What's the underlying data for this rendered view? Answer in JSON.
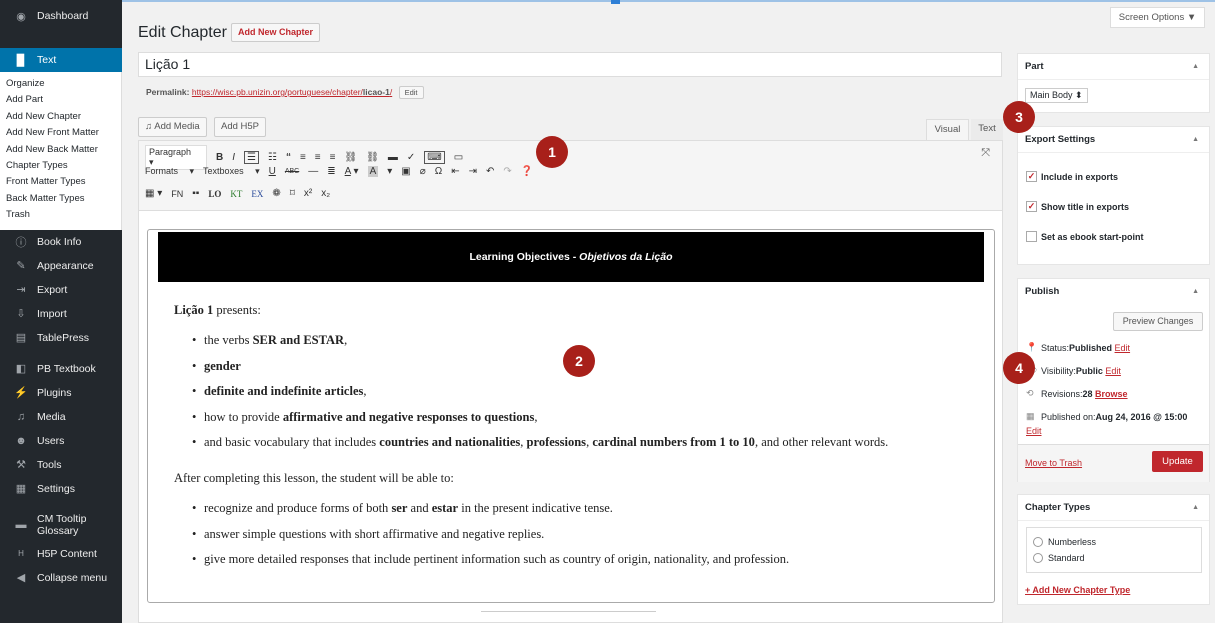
{
  "sidebar": {
    "dashboard": "Dashboard",
    "text": "Text",
    "submenu": [
      "Organize",
      "Add Part",
      "Add New Chapter",
      "Add New Front Matter",
      "Add New Back Matter",
      "Chapter Types",
      "Front Matter Types",
      "Back Matter Types",
      "Trash"
    ],
    "book_info": "Book Info",
    "appearance": "Appearance",
    "export": "Export",
    "import": "Import",
    "tablepress": "TablePress",
    "pb_textbook": "PB Textbook",
    "plugins": "Plugins",
    "media": "Media",
    "users": "Users",
    "tools": "Tools",
    "settings": "Settings",
    "cm_tooltip_1": "CM Tooltip",
    "cm_tooltip_2": "Glossary",
    "h5p": "H5P Content",
    "collapse": "Collapse menu"
  },
  "header": {
    "title": "Edit Chapter",
    "add_new": "Add New Chapter",
    "screen_options": "Screen Options ▼"
  },
  "post": {
    "title_value": "Lição 1",
    "permalink_label": "Permalink:",
    "permalink_url_pre": "https://wisc.pb.unizin.org/portuguese/chapter/",
    "permalink_slug": "licao-1",
    "permalink_url_post": "/",
    "permalink_edit": "Edit"
  },
  "editor": {
    "add_media": "Add Media",
    "add_h5p": "Add H5P",
    "tab_visual": "Visual",
    "tab_text": "Text",
    "paragraph": "Paragraph",
    "formats": "Formats",
    "textboxes": "Textboxes",
    "fn": "FN",
    "lo": "LO",
    "kt": "KT",
    "ex": "EX"
  },
  "content": {
    "lo_title": "Learning Objectives - ",
    "lo_title_italic": "Objetivos da Lição",
    "intro_bold": "Lição 1",
    "intro_rest": " presents:",
    "b1_pre": "the verbs ",
    "b1_bold": "SER and ESTAR",
    "b1_post": ",",
    "b2_bold": "gender",
    "b3_bold": "definite and indefinite articles",
    "b3_post": ",",
    "b4_pre": "how to provide ",
    "b4_bold": "affirmative and negative responses to questions",
    "b4_post": ",",
    "b5_pre": "and basic vocabulary that includes ",
    "b5_bold1": "countries and nationalities",
    "b5_mid1": ", ",
    "b5_bold2": "professions",
    "b5_mid2": ", ",
    "b5_bold3": "cardinal numbers from 1 to 10",
    "b5_post": ", and other relevant words.",
    "after": "After completing this lesson, the student will be able to:",
    "c1_pre": "recognize and produce forms of both ",
    "c1_bold1": "ser",
    "c1_mid": " and ",
    "c1_bold2": "estar",
    "c1_post": " in the present indicative tense.",
    "c2": "answer simple questions with short affirmative and negative replies.",
    "c3": "give more detailed responses that include pertinent information such as country of origin, nationality, and profession."
  },
  "part": {
    "header": "Part",
    "value": "Main Body ⬍"
  },
  "export": {
    "header": "Export Settings",
    "include": "Include in exports",
    "show_title": "Show title in exports",
    "ebook_start": "Set as ebook start-point"
  },
  "publish": {
    "header": "Publish",
    "preview": "Preview Changes",
    "status_label": "Status: ",
    "status_value": "Published",
    "visibility_label": "Visibility: ",
    "visibility_value": "Public",
    "revisions_label": "Revisions: ",
    "revisions_value": "28",
    "browse": "Browse",
    "published_on_label": "Published on: ",
    "published_on_value": "Aug 24, 2016 @ 15:00",
    "edit": "Edit",
    "trash": "Move to Trash",
    "update": "Update"
  },
  "chapter_types": {
    "header": "Chapter Types",
    "opt1": "Numberless",
    "opt2": "Standard",
    "add_new": "+ Add New Chapter Type"
  },
  "markers": [
    "1",
    "2",
    "3",
    "4"
  ]
}
